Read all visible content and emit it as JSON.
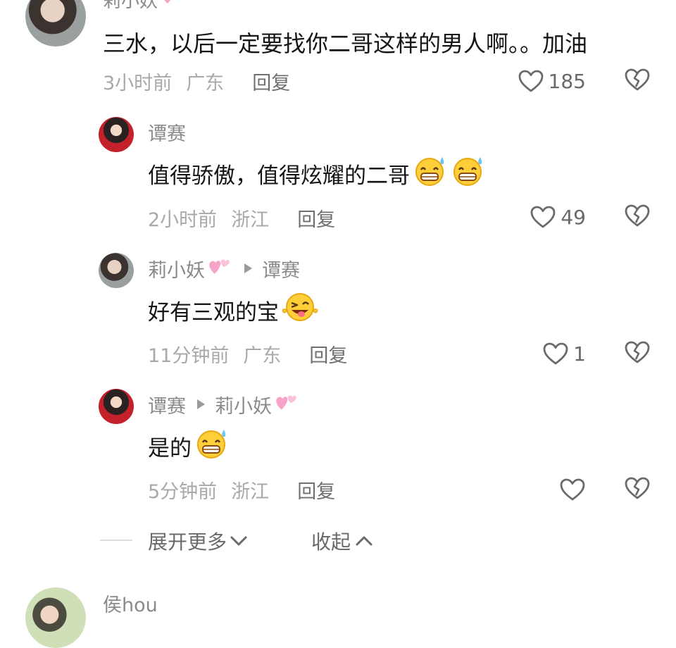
{
  "top_comment": {
    "author": "莉小妖",
    "text": "三水，以后一定要找你二哥这样的男人啊。。加油",
    "time": "3小时前",
    "location": "广东",
    "reply_label": "回复",
    "likes": "185"
  },
  "replies": [
    {
      "author": "谭赛",
      "text": "值得骄傲，值得炫耀的二哥",
      "time": "2小时前",
      "location": "浙江",
      "reply_label": "回复",
      "likes": "49"
    },
    {
      "author": "莉小妖",
      "reply_to": "谭赛",
      "text": "好有三观的宝",
      "time": "11分钟前",
      "location": "广东",
      "reply_label": "回复",
      "likes": "1"
    },
    {
      "author": "谭赛",
      "reply_to": "莉小妖",
      "text": "是的",
      "time": "5分钟前",
      "location": "浙江",
      "reply_label": "回复",
      "likes": ""
    }
  ],
  "controls": {
    "expand_more": "展开更多",
    "collapse": "收起"
  },
  "next_comment": {
    "author": "侯hou"
  },
  "icons": {
    "like": "heart-outline-icon",
    "dislike": "broken-heart-icon",
    "expand": "chevron-down-icon",
    "collapse": "chevron-up-icon",
    "reply_arrow": "triangle-right-icon",
    "emoji_grin_sweat": "grinning-sweat-emoji",
    "emoji_wink_tongue": "winking-tongue-emoji",
    "name_hearts": "pink-hearts-icon"
  },
  "colors": {
    "text": "#161616",
    "name": "#8a8a8a",
    "meta": "#a9a9a9",
    "icon": "#6a6a6a",
    "heart_pink": "#f6a3c7"
  }
}
